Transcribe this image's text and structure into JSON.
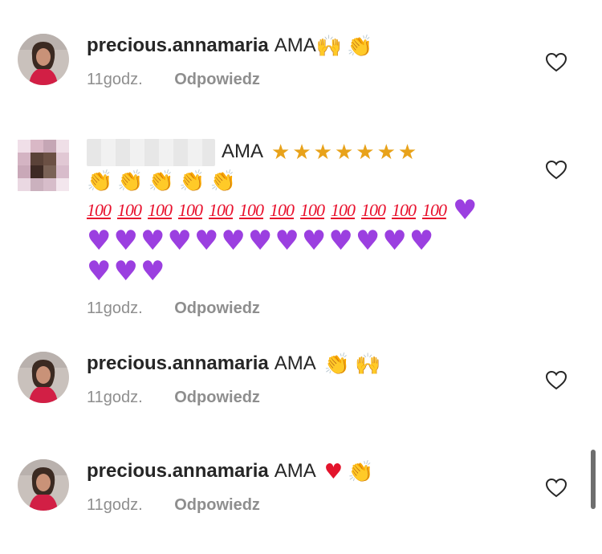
{
  "comments": [
    {
      "username": "precious.annamaria",
      "text": "AMA",
      "emojis": [
        "raised-hands",
        "clapping-hands"
      ],
      "time": "11godz.",
      "reply": "Odpowiedz"
    },
    {
      "username": "",
      "text": "AMA",
      "time": "11godz.",
      "reply": "Odpowiedz"
    },
    {
      "username": "precious.annamaria",
      "text": "AMA",
      "emojis": [
        "clapping-hands",
        "raised-hands"
      ],
      "time": "11godz.",
      "reply": "Odpowiedz"
    },
    {
      "username": "precious.annamaria",
      "text": "AMA",
      "emojis": [
        "red-heart",
        "clapping-hands"
      ],
      "time": "11godz.",
      "reply": "Odpowiedz"
    }
  ],
  "emoji_glyphs": {
    "star": "★",
    "clap": "👏",
    "raised": "🙌",
    "hundred": "100",
    "heart": "♥"
  },
  "colors": {
    "text": "#262626",
    "meta": "#8e8e8e",
    "purple_heart": "#9b3fe0",
    "red_heart": "#e3142c"
  }
}
